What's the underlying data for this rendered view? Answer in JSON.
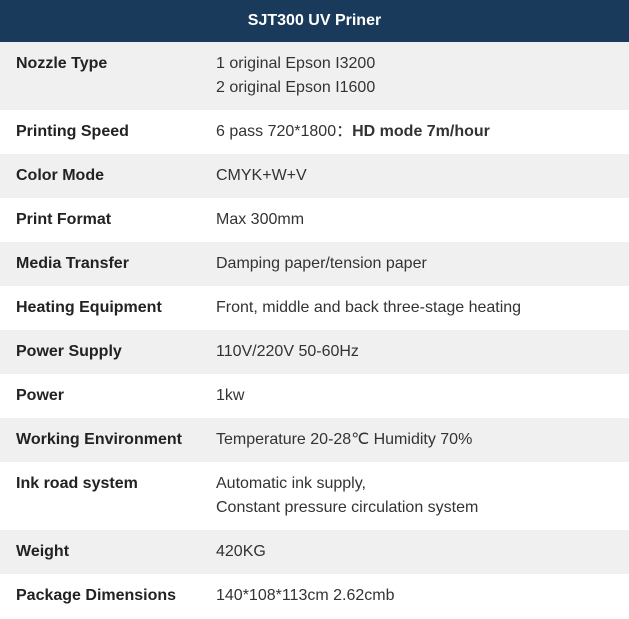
{
  "header": {
    "title": "SJT300 UV Priner"
  },
  "rows": [
    {
      "id": "nozzle-type",
      "label": "Nozzle Type",
      "value": "1 original Epson I3200\n2 original Epson I1600",
      "bold_part": null,
      "row_class": "odd-row"
    },
    {
      "id": "printing-speed",
      "label": "Printing Speed",
      "value_prefix": "6 pass 720*1800：",
      "value_bold": "HD mode 7m/hour",
      "row_class": "even-row"
    },
    {
      "id": "color-mode",
      "label": "Color Mode",
      "value": "CMYK+W+V",
      "row_class": "odd-row"
    },
    {
      "id": "print-format",
      "label": "Print Format",
      "value": "Max 300mm",
      "row_class": "even-row"
    },
    {
      "id": "media-transfer",
      "label": "Media Transfer",
      "value": "Damping paper/tension paper",
      "row_class": "odd-row"
    },
    {
      "id": "heating-equipment",
      "label": "Heating Equipment",
      "value": "Front, middle and back three-stage heating",
      "row_class": "even-row"
    },
    {
      "id": "power-supply",
      "label": "Power Supply",
      "value": "110V/220V 50-60Hz",
      "row_class": "odd-row"
    },
    {
      "id": "power",
      "label": "Power",
      "value": "1kw",
      "row_class": "even-row"
    },
    {
      "id": "working-environment",
      "label": "Working Environment",
      "value": "Temperature 20-28℃  Humidity 70%",
      "row_class": "odd-row"
    },
    {
      "id": "ink-road-system",
      "label": "Ink road system",
      "value": "Automatic ink supply,\nConstant pressure circulation system",
      "row_class": "even-row"
    },
    {
      "id": "weight",
      "label": "Weight",
      "value": "420KG",
      "row_class": "odd-row"
    },
    {
      "id": "package-dimensions",
      "label": "Package Dimensions",
      "value": "140*108*113cm  2.62cmb",
      "row_class": "even-row"
    }
  ]
}
